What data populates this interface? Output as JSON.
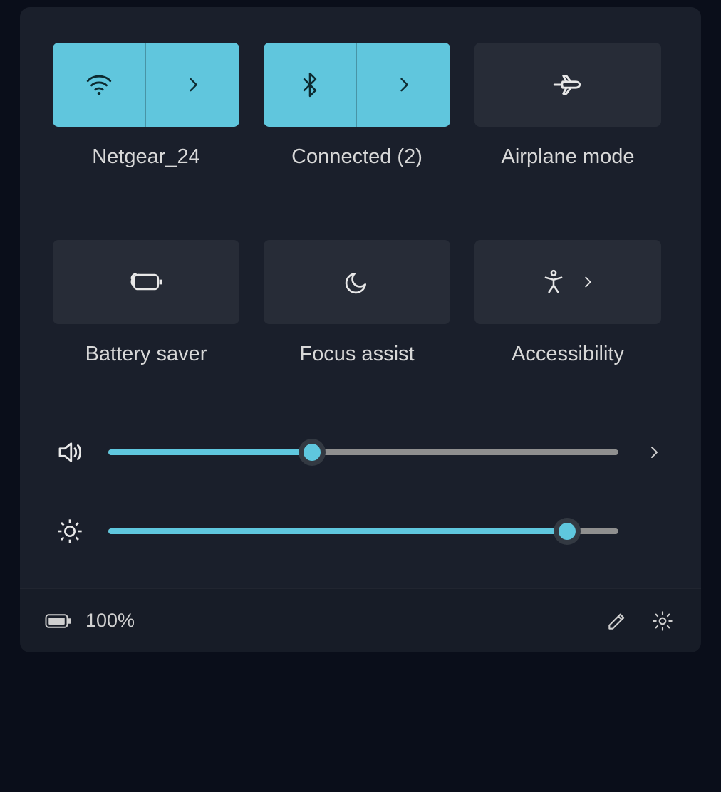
{
  "tiles": {
    "wifi": {
      "label": "Netgear_24",
      "active": true
    },
    "bluetooth": {
      "label": "Connected (2)",
      "active": true
    },
    "airplane": {
      "label": "Airplane mode",
      "active": false
    },
    "battery_saver": {
      "label": "Battery saver",
      "active": false
    },
    "focus_assist": {
      "label": "Focus assist",
      "active": false
    },
    "accessibility": {
      "label": "Accessibility",
      "active": false
    }
  },
  "sliders": {
    "volume": 40,
    "brightness": 90
  },
  "footer": {
    "battery_text": "100%"
  },
  "colors": {
    "accent": "#5fc7de"
  }
}
